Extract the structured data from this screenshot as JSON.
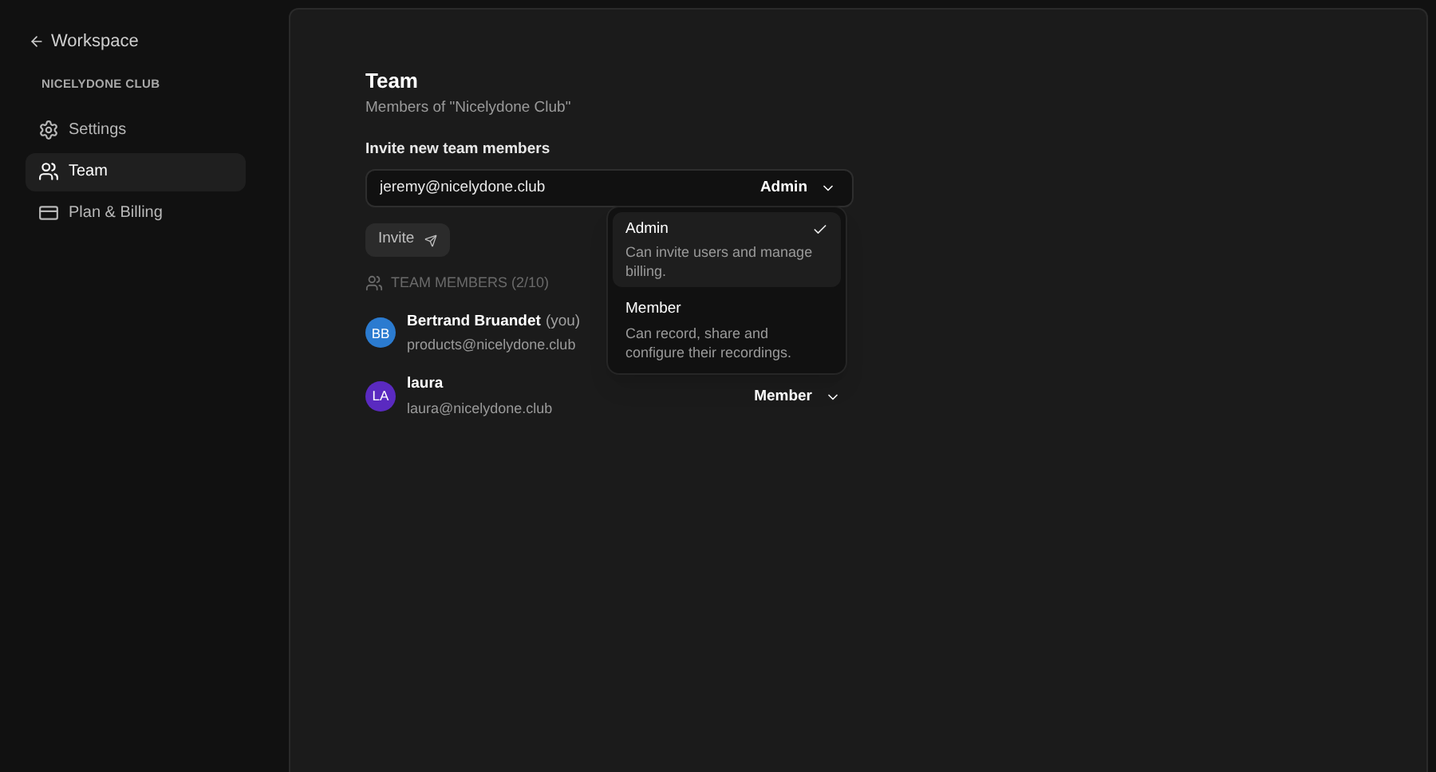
{
  "sidebar": {
    "back_link": "Workspace",
    "section_title": "NICELYDONE CLUB",
    "items": [
      {
        "label": "Settings",
        "kind": "settings",
        "selected": false
      },
      {
        "label": "Team",
        "kind": "team",
        "selected": true
      },
      {
        "label": "Plan & Billing",
        "kind": "card",
        "selected": false
      }
    ]
  },
  "header": {
    "title": "Team",
    "subtitle": "Members of \"Nicelydone Club\""
  },
  "invite": {
    "label": "Invite new team members",
    "email_value": "jeremy@nicelydone.club",
    "role": "Admin",
    "button": "Invite"
  },
  "role_menu": {
    "options": [
      {
        "title": "Admin",
        "description": "Can invite users and manage billing.",
        "selected": true
      },
      {
        "title": "Member",
        "description": "Can record, share and configure their recordings.",
        "selected": false
      }
    ]
  },
  "members": {
    "heading": "TEAM MEMBERS (2/10)",
    "rows": [
      {
        "initials": "BB",
        "color": "#2b7bd0",
        "name": "Bertrand Bruandet",
        "suffix": "(you)",
        "email": "products@nicelydone.club"
      },
      {
        "initials": "LA",
        "color": "#5a2ac0",
        "name": "laura",
        "email": "laura@nicelydone.club",
        "role": "Member"
      }
    ]
  }
}
